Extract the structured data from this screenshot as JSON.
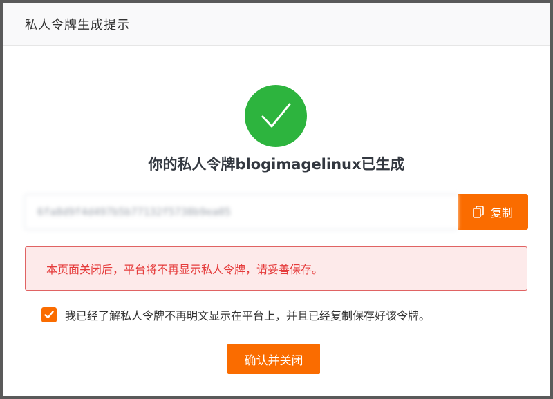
{
  "dialog": {
    "title": "私人令牌生成提示"
  },
  "success": {
    "icon": "check-icon",
    "message": "你的私人令牌blogimagelinux已生成",
    "color": "#2db43e"
  },
  "token": {
    "value": "6fa8d9f4d497b5b77132f5738b9ea05",
    "copy_label": "复制",
    "copy_icon": "copy-icon"
  },
  "warning": {
    "text": "本页面关闭后，平台将不再显示私人令牌，请妥善保存。",
    "color": "#e53b3b"
  },
  "acknowledge": {
    "checked": true,
    "text": "我已经了解私人令牌不再明文显示在平台上，并且已经复制保存好该令牌。"
  },
  "confirm": {
    "label": "确认并关闭"
  },
  "colors": {
    "accent": "#fa6c00"
  }
}
